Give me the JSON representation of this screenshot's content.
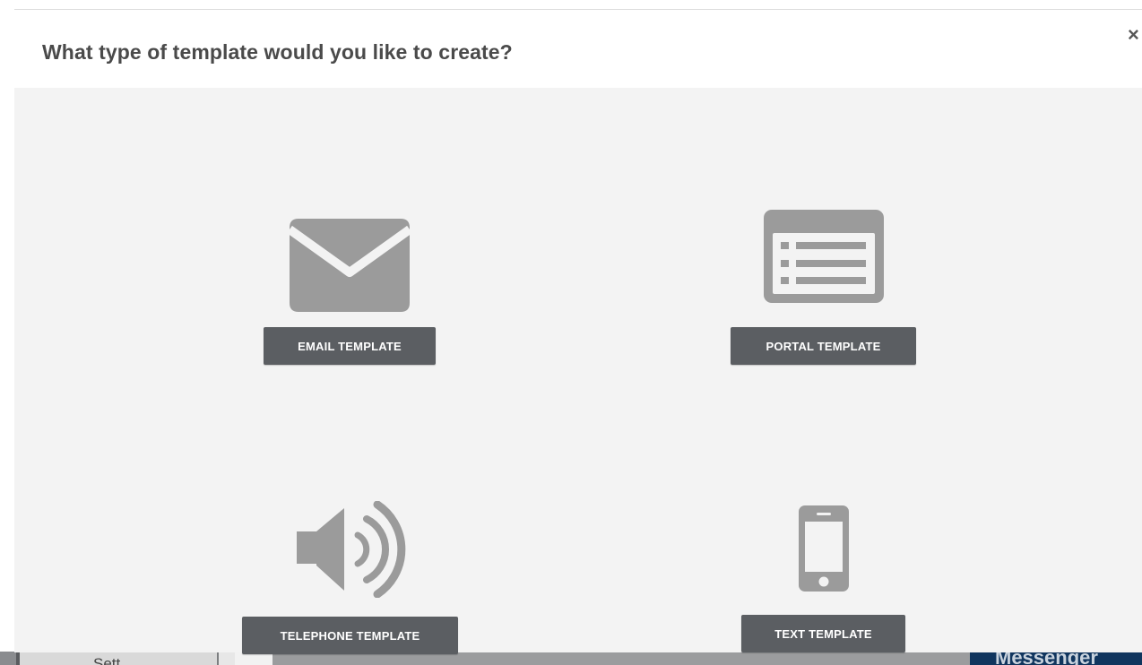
{
  "modal": {
    "title": "What type of template would you like to create?",
    "close_glyph": "×"
  },
  "options": [
    {
      "label": "EMAIL TEMPLATE",
      "icon": "envelope-icon"
    },
    {
      "label": "PORTAL TEMPLATE",
      "icon": "web-page-list-icon"
    },
    {
      "label": "TELEPHONE TEMPLATE",
      "icon": "speaker-volume-icon"
    },
    {
      "label": "TEXT TEMPLATE",
      "icon": "mobile-phone-icon"
    }
  ],
  "background_page": {
    "left_label": "Sett",
    "right_label": "Messenger"
  },
  "colors": {
    "icon_gray": "#9b9b9b",
    "button_bg": "#5b5e62",
    "body_bg": "#f3f3f3",
    "messenger_bg": "#10355e"
  }
}
